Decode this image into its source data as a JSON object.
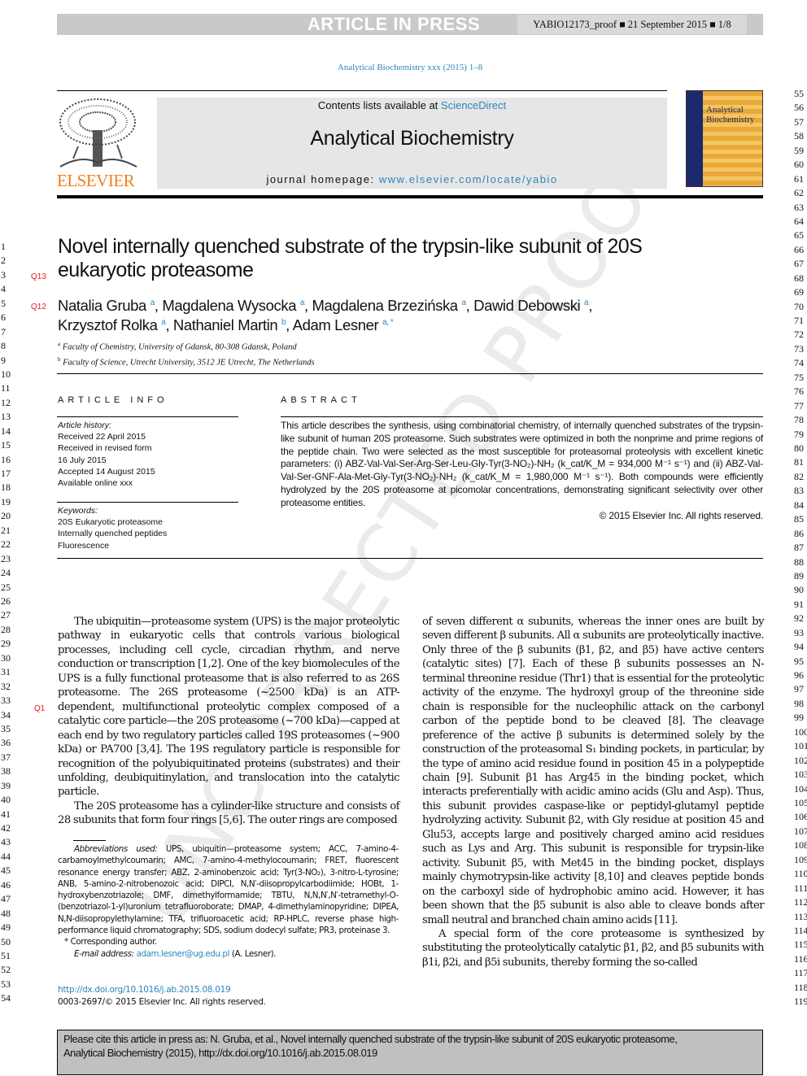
{
  "watermark": "UNCORRECTED PROOF",
  "header": {
    "banner": "ARTICLE IN PRESS",
    "proof_info": "YABIO12173_proof ■ 21 September 2015 ■ 1/8",
    "journal_ref": "Analytical Biochemistry xxx (2015) 1–8"
  },
  "masthead": {
    "publisher": "ELSEVIER",
    "contents_prefix": "Contents lists available at ",
    "contents_link": "ScienceDirect",
    "journal_name": "Analytical Biochemistry",
    "homepage_prefix": "journal homepage: ",
    "homepage_link": "www.elsevier.com/locate/yabio",
    "cover_title": "Analytical Biochemistry",
    "colors": {
      "link": "#2a86bd",
      "publisher": "#f07f1a",
      "query": "#e0201c"
    }
  },
  "article": {
    "title_line1": "Novel internally quenched substrate of the trypsin-like subunit of 20S",
    "title_line2": "eukaryotic proteasome",
    "query_title": "Q13",
    "query_authors": "Q12",
    "query_body": "Q1",
    "authors": [
      {
        "name": "Natalia Gruba",
        "aff": "a"
      },
      {
        "name": "Magdalena Wysocka",
        "aff": "a"
      },
      {
        "name": "Magdalena Brzezińska",
        "aff": "a"
      },
      {
        "name": "Dawid Debowski",
        "aff": "a"
      },
      {
        "name": "Krzysztof Rolka",
        "aff": "a"
      },
      {
        "name": "Nathaniel Martin",
        "aff": "b"
      },
      {
        "name": "Adam Lesner",
        "aff": "a, *"
      }
    ],
    "affiliations": [
      {
        "key": "a",
        "text": "Faculty of Chemistry, University of Gdansk, 80-308 Gdansk, Poland"
      },
      {
        "key": "b",
        "text": "Faculty of Science, Utrecht University, 3512 JE Utrecht, The Netherlands"
      }
    ]
  },
  "article_info": {
    "heading": "ARTICLE INFO",
    "history_label": "Article history:",
    "history": [
      "Received 22 April 2015",
      "Received in revised form",
      "16 July 2015",
      "Accepted 14 August 2015",
      "Available online xxx"
    ],
    "keywords_label": "Keywords:",
    "keywords": [
      "20S Eukaryotic proteasome",
      "Internally quenched peptides",
      "Fluorescence"
    ]
  },
  "abstract": {
    "heading": "ABSTRACT",
    "text": "This article describes the synthesis, using combinatorial chemistry, of internally quenched substrates of the trypsin-like subunit of human 20S proteasome. Such substrates were optimized in both the nonprime and prime regions of the peptide chain. Two were selected as the most susceptible for proteasomal proteolysis with excellent kinetic parameters: (i) ABZ-Val-Val-Ser-Arg-Ser-Leu-Gly-Tyr(3-NO₂)-NH₂ (k_cat/K_M = 934,000 M⁻¹ s⁻¹) and (ii) ABZ-Val-Val-Ser-GNF-Ala-Met-Gly-Tyr(3-NO₂)-NH₂ (k_cat/K_M = 1,980,000 M⁻¹ s⁻¹). Both compounds were efficiently hydrolyzed by the 20S proteasome at picomolar concentrations, demonstrating significant selectivity over other proteasome entities.",
    "copyright": "© 2015 Elsevier Inc. All rights reserved."
  },
  "body": {
    "col1": [
      "The ubiquitin—proteasome system (UPS) is the major proteolytic pathway in eukaryotic cells that controls various biological processes, including cell cycle, circadian rhythm, and nerve conduction or transcription [1,2]. One of the key biomolecules of the UPS is a fully functional proteasome that is also referred to as 26S proteasome. The 26S proteasome (~2500 kDa) is an ATP-dependent, multifunctional proteolytic complex composed of a catalytic core particle—the 20S proteasome (~700 kDa)—capped at each end by two regulatory particles called 19S proteasomes (~900 kDa) or PA700 [3,4]. The 19S regulatory particle is responsible for recognition of the polyubiquitinated proteins (substrates) and their unfolding, deubiquitinylation, and translocation into the catalytic particle.",
      "The 20S proteasome has a cylinder-like structure and consists of 28 subunits that form four rings [5,6]. The outer rings are composed"
    ],
    "col2": [
      "of seven different α subunits, whereas the inner ones are built by seven different β subunits. All α subunits are proteolytically inactive. Only three of the β subunits (β1, β2, and β5) have active centers (catalytic sites) [7]. Each of these β subunits possesses an N-terminal threonine residue (Thr1) that is essential for the proteolytic activity of the enzyme. The hydroxyl group of the threonine side chain is responsible for the nucleophilic attack on the carbonyl carbon of the peptide bond to be cleaved [8]. The cleavage preference of the active β subunits is determined solely by the construction of the proteasomal S₁ binding pockets, in particular, by the type of amino acid residue found in position 45 in a polypeptide chain [9]. Subunit β1 has Arg45 in the binding pocket, which interacts preferentially with acidic amino acids (Glu and Asp). Thus, this subunit provides caspase-like or peptidyl-glutamyl peptide hydrolyzing activity. Subunit β2, with Gly residue at position 45 and Glu53, accepts large and positively charged amino acid residues such as Lys and Arg. This subunit is responsible for trypsin-like activity. Subunit β5, with Met45 in the binding pocket, displays mainly chymotrypsin-like activity [8,10] and cleaves peptide bonds on the carboxyl side of hydrophobic amino acid. However, it has been shown that the β5 subunit is also able to cleave bonds after small neutral and branched chain amino acids [11].",
      "A special form of the core proteasome is synthesized by substituting the proteolytically catalytic β1, β2, and β5 subunits with β1i, β2i, and β5i subunits, thereby forming the so-called"
    ]
  },
  "footnotes": {
    "abbrev_label": "Abbreviations used:",
    "abbrev_text": " UPS, ubiquitin—proteasome system; ACC, 7-amino-4-carbamoylmethylcoumarin; AMC, 7-amino-4-methylocoumarin; FRET, fluorescent resonance energy transfer; ABZ, 2-aminobenzoic acid; Tyr(3-NO₂), 3-nitro-L-tyrosine; ANB, 5-amino-2-nitrobenozoic acid; DIPCI, N,N′-diisopropylcarbodiimide; HOBt, 1-hydroxybenzotriazole; DMF, dimethylformamide; TBTU, N,N,N′,N′-tetramethyl-O-(benzotriazol-1-yl)uronium tetrafluoroborate; DMAP, 4-dimethylaminopyridine; DIPEA, N,N-diisopropylethylamine; TFA, trifluoroacetic acid; RP-HPLC, reverse phase high-performance liquid chromatography; SDS, sodium dodecyl sulfate; PR3, proteinase 3.",
    "corresponding": "* Corresponding author.",
    "email_label": "E-mail address: ",
    "email": "adam.lesner@ug.edu.pl",
    "email_suffix": " (A. Lesner).",
    "doi": "http://dx.doi.org/10.1016/j.ab.2015.08.019",
    "issn": "0003-2697/© 2015 Elsevier Inc. All rights reserved."
  },
  "cite_box": {
    "line1": "Please cite this article in press as: N. Gruba, et al., Novel internally quenched substrate of the trypsin-like subunit of 20S eukaryotic proteasome,",
    "line2": "Analytical Biochemistry (2015), http://dx.doi.org/10.1016/j.ab.2015.08.019"
  },
  "line_numbers": {
    "left": {
      "start": 1,
      "end": 54
    },
    "right": {
      "start": 55,
      "end": 119
    }
  }
}
